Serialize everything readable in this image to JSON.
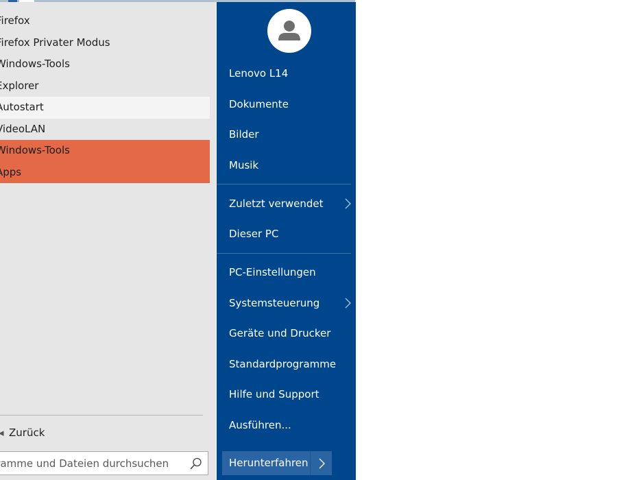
{
  "programs": [
    {
      "label": "Firefox"
    },
    {
      "label": "Firefox Privater Modus"
    },
    {
      "label": "Windows-Tools"
    },
    {
      "label": "Explorer"
    },
    {
      "label": "Autostart"
    },
    {
      "label": "VideoLAN"
    },
    {
      "label": "Windows-Tools"
    },
    {
      "label": "Apps"
    }
  ],
  "back_label": "Zurück",
  "search": {
    "placeholder": "Programme und Dateien durchsuchen",
    "icon": "search-icon"
  },
  "right_menu": {
    "avatar_icon": "user-avatar-icon",
    "items": [
      {
        "label": "Lenovo L14"
      },
      {
        "label": "Dokumente"
      },
      {
        "label": "Bilder"
      },
      {
        "label": "Musik"
      },
      {
        "label": "Zuletzt verwendet",
        "has_submenu": true
      },
      {
        "label": "Dieser PC"
      },
      {
        "label": "PC-Einstellungen"
      },
      {
        "label": "Systemsteuerung",
        "has_submenu": true
      },
      {
        "label": "Geräte und Drucker"
      },
      {
        "label": "Standardprogramme"
      },
      {
        "label": "Hilfe und Support"
      },
      {
        "label": "Ausführen..."
      }
    ]
  },
  "shutdown": {
    "label": "Herunterfahren",
    "more_icon": "chevron-right-icon"
  },
  "colors": {
    "left_pane_bg": "#e6e6e6",
    "right_pane_bg": "#00468c",
    "selection": "#e46a47",
    "hover": "#f4f4f4",
    "shutdown_button": "#2b64a3"
  }
}
